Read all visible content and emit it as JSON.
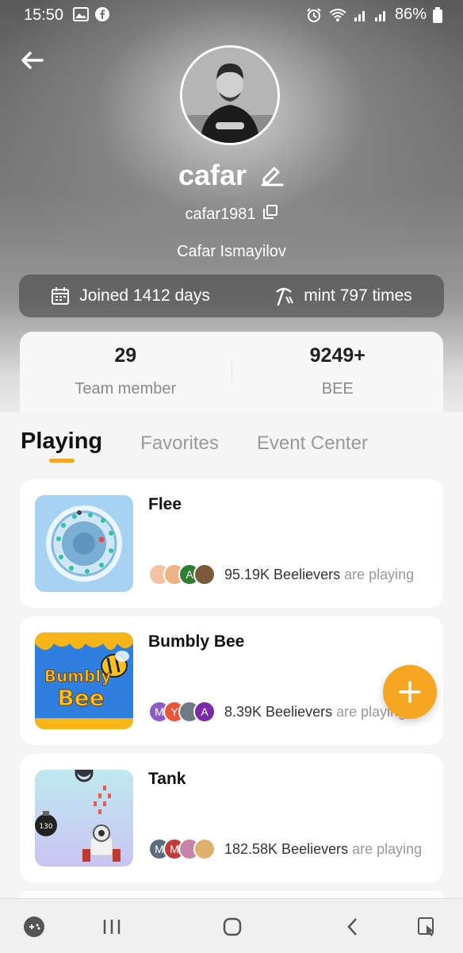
{
  "status_bar": {
    "time": "15:50",
    "battery": "86%"
  },
  "profile": {
    "name": "cafar",
    "username": "cafar1981",
    "full_name": "Cafar Ismayilov",
    "joined": "Joined 1412 days",
    "mint": "mint 797 times"
  },
  "stats": [
    {
      "value": "29",
      "label": "Team member"
    },
    {
      "value": "9249+",
      "label": "BEE"
    }
  ],
  "tabs": [
    {
      "label": "Playing",
      "active": true
    },
    {
      "label": "Favorites",
      "active": false
    },
    {
      "label": "Event Center",
      "active": false
    }
  ],
  "games": [
    {
      "title": "Flee",
      "count": "95.19K Beelievers",
      "suffix": "are playing",
      "avatars": [
        "",
        "",
        "A",
        ""
      ]
    },
    {
      "title": "Bumbly Bee",
      "count": "8.39K Beelievers",
      "suffix": "are playing",
      "avatars": [
        "M",
        "Y",
        "",
        "A"
      ]
    },
    {
      "title": "Tank",
      "count": "182.58K Beelievers",
      "suffix": "are playing",
      "avatars": [
        "M",
        "M",
        "",
        ""
      ]
    }
  ],
  "thumb_text": {
    "bumbly_line1": "Bumbly",
    "bumbly_line2": "Bee",
    "tank_bomb": "130"
  },
  "colors": {
    "accent": "#f5a623",
    "muted": "#9a9a9a"
  }
}
